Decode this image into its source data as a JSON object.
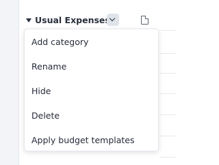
{
  "group": {
    "title": "Usual Expenses"
  },
  "menu": {
    "items": [
      {
        "label": "Add category"
      },
      {
        "label": "Rename"
      },
      {
        "label": "Hide"
      },
      {
        "label": "Delete"
      },
      {
        "label": "Apply budget templates"
      }
    ]
  },
  "icons": {
    "collapse": "caret-down-icon",
    "menu_toggle": "chevron-down-icon",
    "notes": "document-icon"
  },
  "colors": {
    "header_text": "#2a2f3d",
    "menu_text": "#262b3a",
    "toggle_bg": "#dfe3ea",
    "sidebar_bg": "#f2f4f8"
  }
}
